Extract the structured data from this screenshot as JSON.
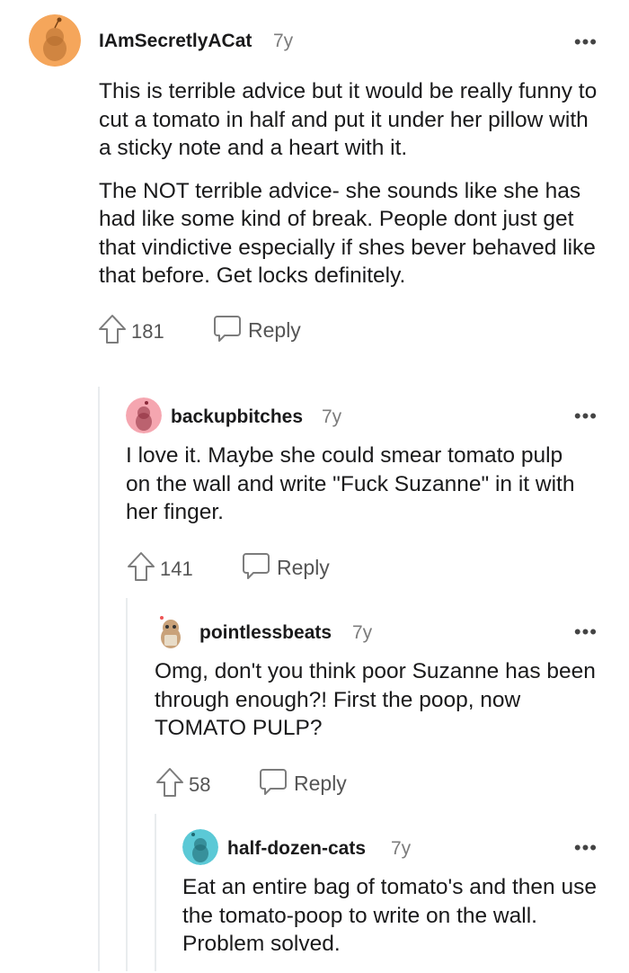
{
  "comments": [
    {
      "username": "IAmSecretlyACat",
      "age": "7y",
      "paragraphs": [
        "This is terrible advice but it would be really funny to cut a tomato in half and put it under her pillow with a sticky note and a heart with it.",
        "The NOT terrible advice- she sounds like she has had like some kind of break. People dont just get that vindictive especially if shes bever behaved like that before. Get locks definitely."
      ],
      "score": "181",
      "reply_label": "Reply",
      "more": "•••",
      "avatar_color": "#f5a65b"
    },
    {
      "username": "backupbitches",
      "age": "7y",
      "paragraphs": [
        "I love it. Maybe she could smear tomato pulp on the wall and write \"Fuck Suzanne\" in it with her finger."
      ],
      "score": "141",
      "reply_label": "Reply",
      "more": "•••",
      "avatar_color": "#f5a6b0"
    },
    {
      "username": "pointlessbeats",
      "age": "7y",
      "paragraphs": [
        "Omg, don't you think poor Suzanne has been through enough?! First the poop, now TOMATO PULP?"
      ],
      "score": "58",
      "reply_label": "Reply",
      "more": "•••",
      "avatar_color": "#c9a27a"
    },
    {
      "username": "half-dozen-cats",
      "age": "7y",
      "paragraphs": [
        "Eat an entire bag of tomato's and then use the tomato-poop to write on the wall. Problem solved."
      ],
      "more": "•••",
      "avatar_color": "#5bc9d6"
    }
  ]
}
